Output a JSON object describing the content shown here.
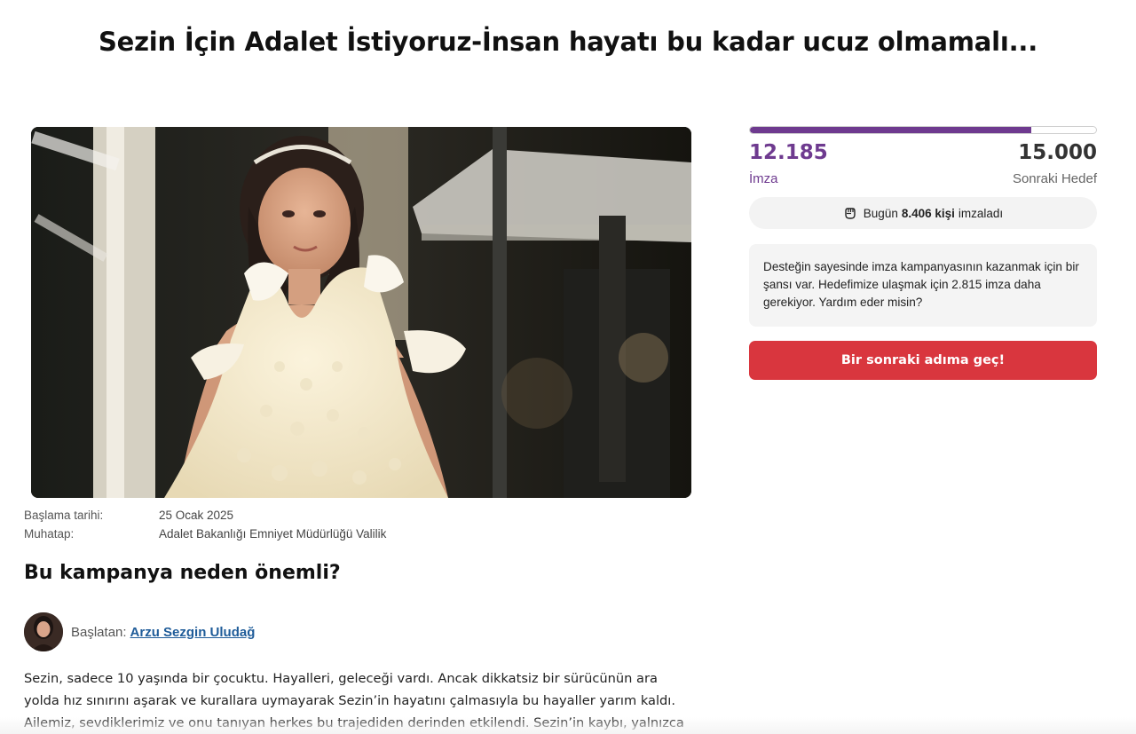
{
  "page": {
    "title": "Sezin İçin Adalet İstiyoruz-İnsan hayatı bu kadar ucuz olmamalı..."
  },
  "hero": {
    "icon": "campaign-photo"
  },
  "meta": {
    "start_label": "Başlama tarihi:",
    "start_value": "25 Ocak 2025",
    "target_label": "Muhatap:",
    "target_value": "Adalet Bakanlığı Emniyet Müdürlüğü Valilik"
  },
  "section": {
    "heading": "Bu kampanya neden önemli?"
  },
  "starter": {
    "label": "Başlatan:",
    "name": "Arzu Sezgin Uludağ"
  },
  "body": {
    "line1": "Sezin, sadece 10 yaşında bir çocuktu. Hayalleri, geleceği vardı. Ancak dikkatsiz bir sürücünün ara",
    "line2": "yolda hız sınırını aşarak ve kurallara uymayarak Sezin’in hayatını çalmasıyla bu hayaller yarım kaldı.",
    "line3": "Ailemiz, sevdiklerimiz ve onu tanıyan herkes bu trajediden derinden etkilendi. Sezin’in kaybı, yalnızca"
  },
  "petition": {
    "signed": "12.185",
    "goal": "15.000",
    "progress_fraction": 0.8123,
    "signed_label": "İmza",
    "goal_label": "Sonraki Hedef",
    "today_prefix": "Bugün",
    "today_count": "8.406 kişi",
    "today_suffix": "imzaladı",
    "today_icon": "fist-icon",
    "info_text": "Desteğin sayesinde imza kampanyasının kazanmak için bir şansı var. Hedefimize ulaşmak için 2.815 imza daha gerekiyor. Yardım eder misin?",
    "cta_label": "Bir sonraki adıma geç!"
  },
  "colors": {
    "accent_purple": "#6e3a8f",
    "cta_red": "#d9363e",
    "link_blue": "#1f5c99"
  }
}
